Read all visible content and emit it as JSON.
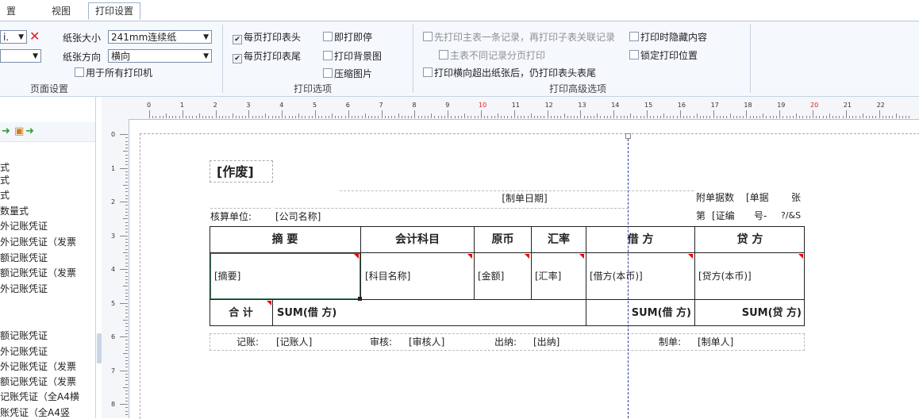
{
  "menu": {
    "tabs": [
      "置",
      "视图",
      "打印设置"
    ]
  },
  "ribbon": {
    "page_setup": {
      "partial_select": "i.",
      "paper_size_label": "纸张大小",
      "paper_size_value": "241mm连续纸",
      "paper_dir_label": "纸张方向",
      "paper_dir_value": "横向",
      "all_printers": "用于所有打印机",
      "group": "页面设置"
    },
    "print_options": {
      "header_each": "每页打印表头",
      "footer_each": "每页打印表尾",
      "print_stop": "即打即停",
      "print_bg": "打印背景图",
      "compress": "压缩图片",
      "group": "打印选项"
    },
    "advanced": {
      "master_first": "先打印主表一条记录，再打印子表关联记录",
      "no_page_split": "主表不同记录分页打印",
      "overflow_header": "打印横向超出纸张后，仍打印表头表尾",
      "hide_content": "打印时隐藏内容",
      "lock_pos": "锁定打印位置",
      "group": "打印高级选项"
    }
  },
  "left_panel": {
    "items": [
      "式",
      "式",
      "式",
      "数量式",
      "外记账凭证",
      "外记账凭证（发票",
      "额记账凭证",
      "额记账凭证（发票",
      "外记账凭证",
      "额记账凭证",
      "外记账凭证",
      "外记账凭证（发票",
      "额记账凭证（发票",
      "记账凭证（全A4横",
      "账凭证（全A4竖"
    ]
  },
  "rulers": {
    "h": [
      "0",
      "1",
      "2",
      "3",
      "4",
      "5",
      "6",
      "7",
      "8",
      "9",
      "10",
      "11",
      "12",
      "13",
      "14",
      "15",
      "16",
      "17",
      "18",
      "19",
      "20",
      "21",
      "22"
    ],
    "v": [
      "0",
      "1",
      "2",
      "3",
      "4",
      "5",
      "6",
      "7",
      "8"
    ]
  },
  "voucher": {
    "void": "[作废]",
    "date": "[制单日期]",
    "attach": "附单据数",
    "attach_field": "[单据",
    "unit_zhang": "张",
    "org_label": "核算单位:",
    "org_value": "[公司名称]",
    "num_label": "第",
    "num_field": "[证编",
    "hao": "号-",
    "num_tail": "?/&S",
    "headers": [
      "摘  要",
      "会计科目",
      "原币",
      "汇率",
      "借  方",
      "贷  方"
    ],
    "row": [
      "[摘要]",
      "[科目名称]",
      "[金额]",
      "[汇率]",
      "[借方(本币)]",
      "[贷方(本币)]"
    ],
    "total_label": "合  计",
    "total_sum_text": "SUM(借  方)",
    "total_debit": "SUM(借  方)",
    "total_credit": "SUM(贷  方)",
    "footer": {
      "bookkeeper_label": "记账:",
      "bookkeeper": "[记账人]",
      "auditor_label": "审核:",
      "auditor": "[审核人]",
      "cashier_label": "出纳:",
      "cashier": "[出纳]",
      "maker_label": "制单:",
      "maker": "[制单人]"
    }
  },
  "colors": {
    "accent_red": "#e00000",
    "dash_blue": "#2b3b9e"
  }
}
